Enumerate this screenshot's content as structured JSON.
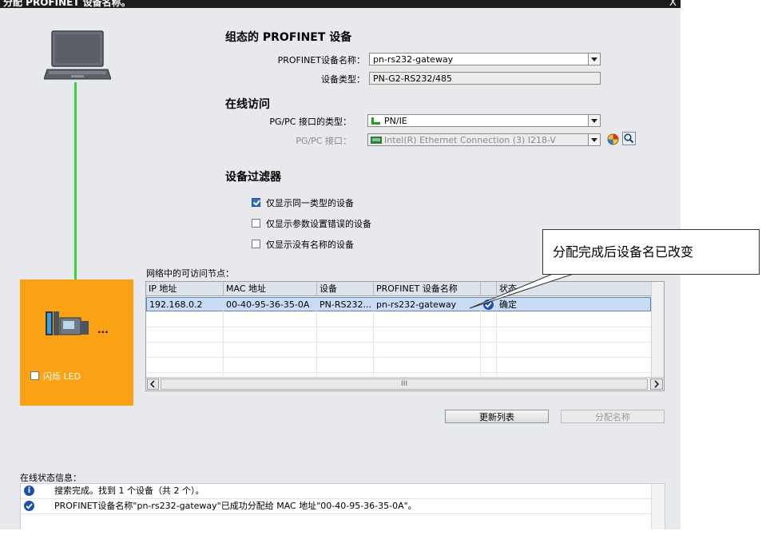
{
  "window": {
    "title": "分配 PROFINET 设备名称。",
    "close_label": "X"
  },
  "configured": {
    "heading": "组态的 PROFINET 设备",
    "name_label": "PROFINET设备名称：",
    "name_value": "pn-rs232-gateway",
    "type_label": "设备类型：",
    "type_value": "PN-G2-RS232/485"
  },
  "online": {
    "heading": "在线访问",
    "iface_type_label": "PG/PC 接口的类型：",
    "iface_type_value": "PN/IE",
    "iface_label": "PG/PC 接口：",
    "iface_value": "Intel(R) Ethernet Connection (3) I218-V"
  },
  "filter": {
    "heading": "设备过滤器",
    "options": [
      {
        "label": "仅显示同一类型的设备",
        "checked": true
      },
      {
        "label": "仅显示参数设置错误的设备",
        "checked": false
      },
      {
        "label": "仅显示没有名称的设备",
        "checked": false
      }
    ]
  },
  "nodes": {
    "title": "网络中的可访问节点：",
    "columns": [
      "IP 地址",
      "MAC 地址",
      "设备",
      "PROFINET 设备名称",
      "",
      "状态"
    ],
    "rows": [
      {
        "ip": "192.168.0.2",
        "mac": "00-40-95-36-35-0A",
        "device": "PN-RS232...",
        "name": "pn-rs232-gateway",
        "status": "确定"
      }
    ],
    "scroll_thumb": "III"
  },
  "led": {
    "label": "闪烁 LED",
    "device_ellipsis": "..."
  },
  "buttons": {
    "refresh": "更新列表",
    "assign": "分配名称"
  },
  "status": {
    "title": "在线状态信息：",
    "messages": [
      {
        "icon": "info-icon",
        "text": "搜索完成。找到 1 个设备（共 2 个）。"
      },
      {
        "icon": "check-icon",
        "text": "PROFINET设备名称\"pn-rs232-gateway\"已成功分配给 MAC 地址\"00-40-95-36-35-0A\"。"
      }
    ]
  },
  "callout": {
    "text": "分配完成后设备名已改变"
  },
  "colors": {
    "panel_orange": "#fba214",
    "link_green": "#3bd13b",
    "selected_row": "#c9dcf5",
    "status_icon_blue": "#1d4fb0"
  }
}
